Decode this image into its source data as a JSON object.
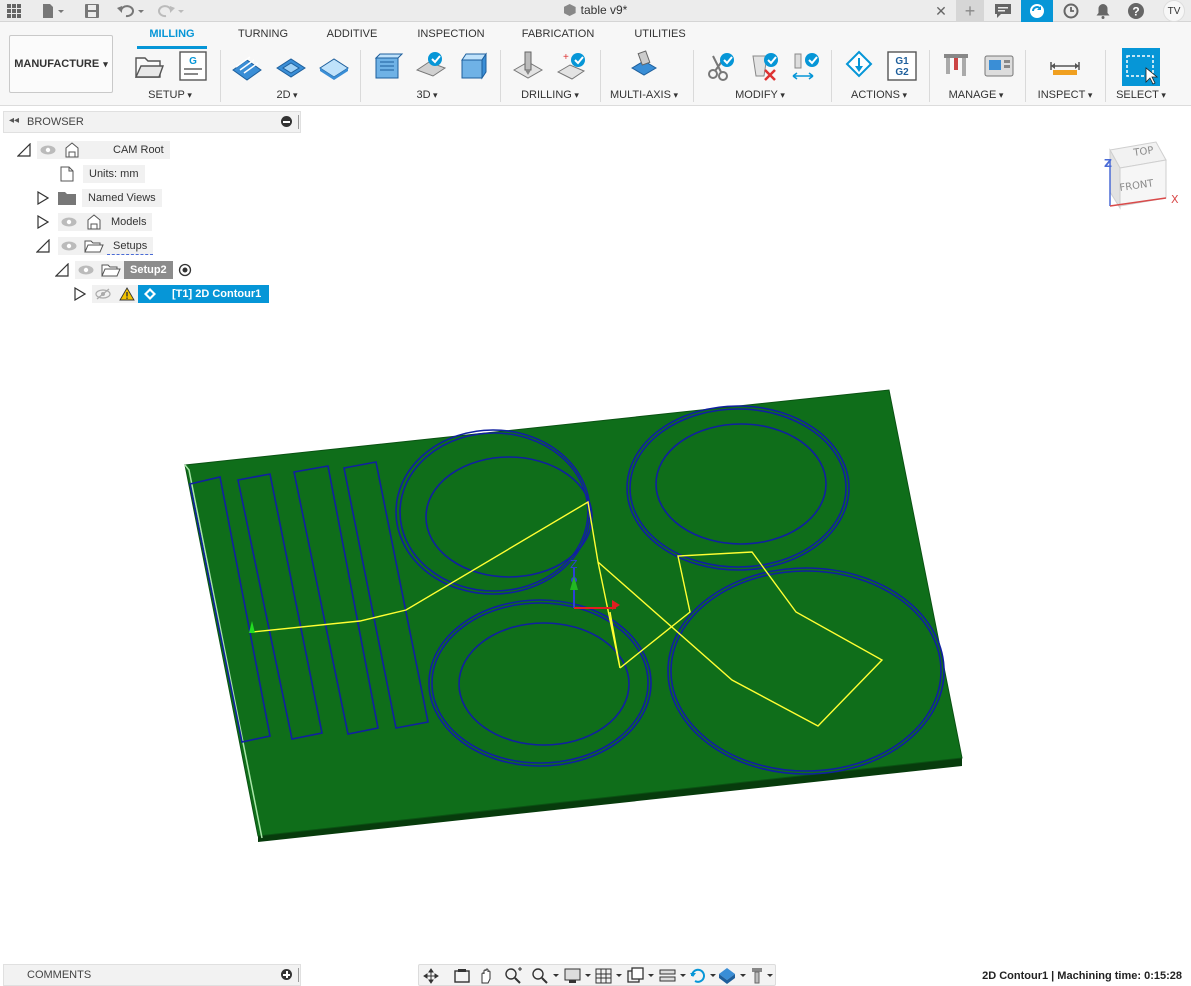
{
  "window": {
    "title": "table v9*",
    "user_initials": "TV"
  },
  "workspace": {
    "label": "MANUFACTURE"
  },
  "tabs": [
    "MILLING",
    "TURNING",
    "ADDITIVE",
    "INSPECTION",
    "FABRICATION",
    "UTILITIES"
  ],
  "active_tab": "MILLING",
  "groups": [
    "SETUP",
    "2D",
    "3D",
    "DRILLING",
    "MULTI-AXIS",
    "MODIFY",
    "ACTIONS",
    "MANAGE",
    "INSPECT",
    "SELECT"
  ],
  "browser": {
    "title": "BROWSER",
    "items": [
      {
        "label": "CAM Root"
      },
      {
        "label": "Units: mm"
      },
      {
        "label": "Named Views"
      },
      {
        "label": "Models"
      },
      {
        "label": "Setups"
      },
      {
        "label": "Setup2"
      },
      {
        "label": "[T1] 2D Contour1"
      }
    ]
  },
  "viewcube": {
    "top": "TOP",
    "front": "FRONT",
    "axis_z": "Z",
    "axis_x": "X"
  },
  "viewport": {
    "axis_z": "Z",
    "stock_color": "#0f6e1a",
    "toolpath_color": "#ffff33",
    "contour_color": "#1020a0"
  },
  "comments": {
    "title": "COMMENTS"
  },
  "status": {
    "text": "2D Contour1 | Machining time: 0:15:28"
  },
  "colors": {
    "accent": "#0696d7",
    "warning": "#f2c200"
  }
}
